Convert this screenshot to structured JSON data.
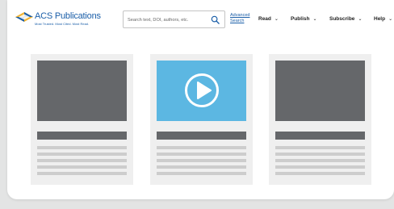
{
  "brand": {
    "name": "ACS Publications",
    "tagline": "Most Trusted. Most Cited. Most Read."
  },
  "search": {
    "placeholder": "Search text, DOI, authors, etc.",
    "advanced_label": "Advanced Search"
  },
  "nav": {
    "items": [
      {
        "label": "Read",
        "icon": "chevron-down-icon"
      },
      {
        "label": "Publish",
        "icon": "chevron-down-icon"
      },
      {
        "label": "Subscribe",
        "icon": "chevron-down-icon"
      },
      {
        "label": "Help",
        "icon": "chevron-down-icon"
      }
    ]
  },
  "cards": [
    {
      "type": "image-placeholder"
    },
    {
      "type": "video",
      "icon": "play-icon"
    },
    {
      "type": "image-placeholder"
    }
  ],
  "colors": {
    "brand_blue": "#1a5ea8",
    "placeholder_dark": "#65676a",
    "video_blue": "#5cb7e2",
    "line_gray": "#cdcdcd",
    "card_bg": "#efefef"
  }
}
